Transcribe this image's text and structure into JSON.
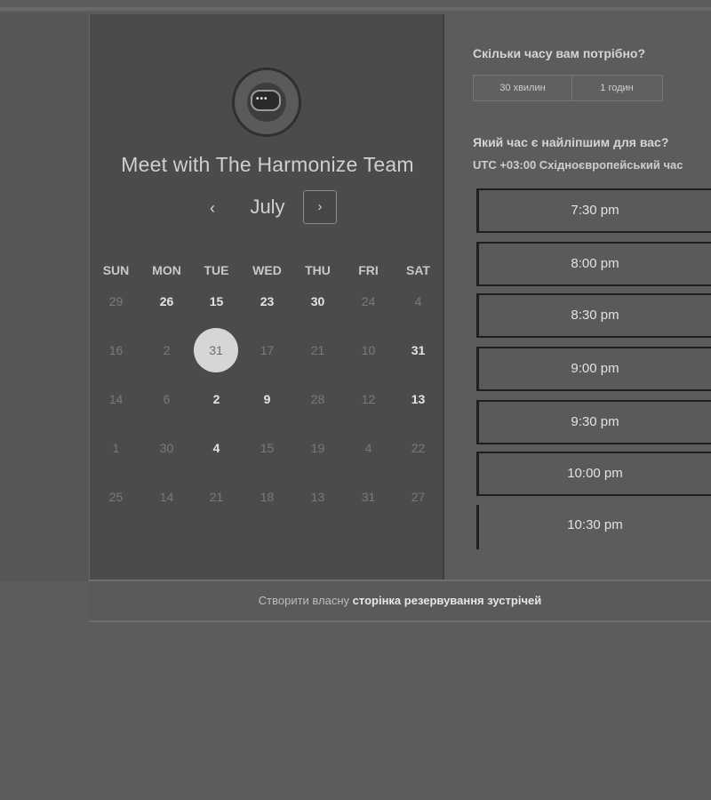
{
  "calendar": {
    "title": "Meet with The Harmonize Team",
    "month": "July",
    "prev_icon": "‹",
    "next_icon": "›",
    "weekdays": [
      "SUN",
      "MON",
      "TUE",
      "WED",
      "THU",
      "FRI",
      "SAT"
    ],
    "weeks": [
      [
        "29",
        "26",
        "15",
        "23",
        "30",
        "24",
        "4"
      ],
      [
        "16",
        "2",
        "31",
        "17",
        "21",
        "10",
        "31"
      ],
      [
        "14",
        "6",
        "2",
        "9",
        "28",
        "12",
        "13"
      ],
      [
        "1",
        "30",
        "4",
        "15",
        "19",
        "4",
        "22"
      ],
      [
        "25",
        "14",
        "21",
        "18",
        "13",
        "31",
        "27"
      ]
    ]
  },
  "duration": {
    "question": "Скільки часу вам потрібно?",
    "options": [
      "30 хвилин",
      "1 годин"
    ]
  },
  "times": {
    "question": "Який час є найліпшим для вас?",
    "timezone": "UTC +03:00 Східноєвропейський час",
    "slots": [
      "7:30 pm",
      "8:00 pm",
      "8:30 pm",
      "9:00 pm",
      "9:30 pm",
      "10:00 pm",
      "10:30 pm"
    ]
  },
  "footer": {
    "prefix": "Створити власну",
    "link": "сторінка резервування зустрічей"
  },
  "colors": {
    "page_background": "#5c5c5c",
    "calendar_background": "#4b4b4b",
    "selected_day": "#d6d6d6"
  }
}
